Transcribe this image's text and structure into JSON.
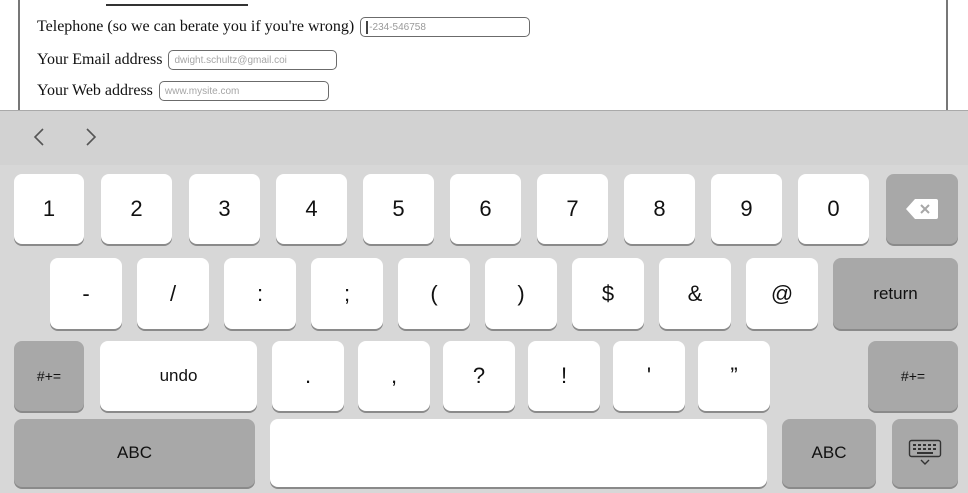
{
  "form": {
    "telephone": {
      "label": "Telephone (so we can berate you if you're wrong)",
      "value": "-234-546758"
    },
    "email": {
      "label": "Your Email address",
      "placeholder": "dwight.schultz@gmail.coi"
    },
    "web": {
      "label": "Your Web address",
      "placeholder": "www.mysite.com"
    }
  },
  "keyboard": {
    "nav": {
      "prev_icon": "chevron-left-icon",
      "next_icon": "chevron-right-icon"
    },
    "row1": [
      "1",
      "2",
      "3",
      "4",
      "5",
      "6",
      "7",
      "8",
      "9",
      "0"
    ],
    "delete_icon": "backspace-icon",
    "row2": [
      "-",
      "/",
      ":",
      ";",
      "(",
      ")",
      "$",
      "&",
      "@"
    ],
    "return_label": "return",
    "row3": {
      "shift_left": "#+=",
      "undo": "undo",
      "keys": [
        ".",
        ",",
        "?",
        "!",
        "'",
        "”"
      ],
      "shift_right": "#+="
    },
    "row4": {
      "abc_left": "ABC",
      "space": "",
      "abc_right": "ABC",
      "dismiss_icon": "keyboard-dismiss-icon"
    }
  },
  "colors": {
    "keyboard_bg": "#d7d7d7",
    "key_light": "#ffffff",
    "key_dark": "#a8a8a8",
    "delete_icon": "#ffffff"
  }
}
